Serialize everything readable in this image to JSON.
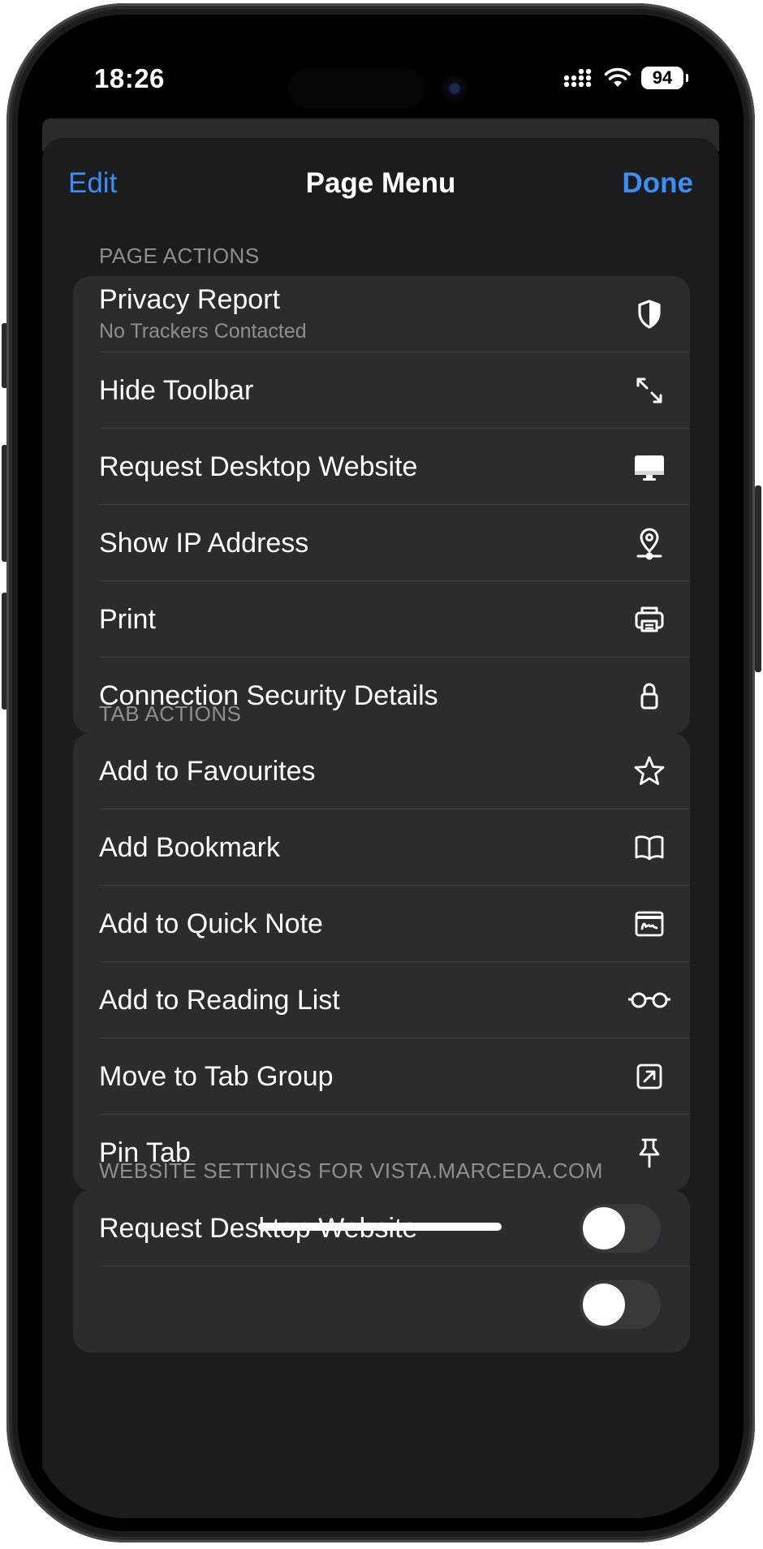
{
  "status": {
    "time": "18:26",
    "battery": "94"
  },
  "nav": {
    "edit_label": "Edit",
    "title": "Page Menu",
    "done_label": "Done"
  },
  "page_actions": {
    "header": "PAGE ACTIONS",
    "items": [
      {
        "label": "Privacy Report",
        "sub": "No Trackers Contacted",
        "icon": "shield-icon"
      },
      {
        "label": "Hide Toolbar",
        "icon": "expand-arrows-icon"
      },
      {
        "label": "Request Desktop Website",
        "icon": "desktop-icon"
      },
      {
        "label": "Show IP Address",
        "icon": "location-pin-icon"
      },
      {
        "label": "Print",
        "icon": "printer-icon"
      },
      {
        "label": "Connection Security Details",
        "icon": "lock-icon"
      }
    ]
  },
  "tab_actions": {
    "header": "TAB ACTIONS",
    "items": [
      {
        "label": "Add to Favourites",
        "icon": "star-icon"
      },
      {
        "label": "Add Bookmark",
        "icon": "book-icon"
      },
      {
        "label": "Add to Quick Note",
        "icon": "quick-note-icon"
      },
      {
        "label": "Add to Reading List",
        "icon": "glasses-icon"
      },
      {
        "label": "Move to Tab Group",
        "icon": "arrow-square-icon"
      },
      {
        "label": "Pin Tab",
        "icon": "pin-icon"
      }
    ]
  },
  "website_settings": {
    "header": "WEBSITE SETTINGS FOR VISTA.MARCEDA.COM",
    "items": [
      {
        "label": "Request Desktop Website",
        "toggle_on": false
      }
    ]
  },
  "colors": {
    "accent": "#3b8ff3",
    "sheet_bg": "#1c1c1e",
    "group_bg": "#2c2c2e",
    "secondary_text": "#8e8e93"
  }
}
